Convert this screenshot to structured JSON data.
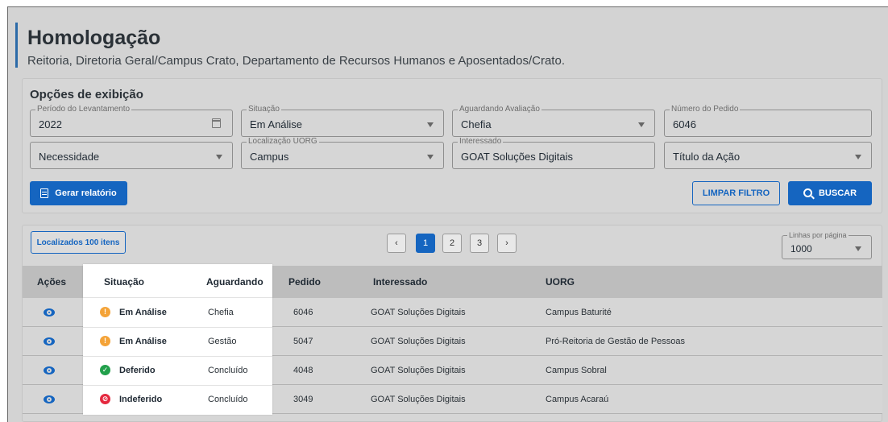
{
  "header": {
    "title": "Homologação",
    "subtitle": "Reitoria, Diretoria Geral/Campus Crato, Departamento de Recursos Humanos e Aposentados/Crato."
  },
  "filters": {
    "heading": "Opções de exibição",
    "periodo": {
      "legend": "Período do Levantamento",
      "value": "2022"
    },
    "situacao": {
      "legend": "Situação",
      "value": "Em Análise"
    },
    "aguardando": {
      "legend": "Aguardando Avaliação",
      "value": "Chefia"
    },
    "numero": {
      "legend": "Número do Pedido",
      "value": "6046"
    },
    "necessidade": {
      "value": "Necessidade"
    },
    "localizacao": {
      "legend": "Localização UORG",
      "value": "Campus"
    },
    "interessado": {
      "legend": "Interessado",
      "value": "GOAT Soluções Digitais"
    },
    "titulo": {
      "value": "Título da Ação"
    },
    "gerar_label": "Gerar relatório",
    "limpar_label": "LIMPAR FILTRO",
    "buscar_label": "BUSCAR"
  },
  "results": {
    "count_label": "Localizados 100 itens",
    "pages": [
      "1",
      "2",
      "3"
    ],
    "active_page": "1",
    "prev_symbol": "‹",
    "next_symbol": "›",
    "rows_per_page_legend": "Linhas por página",
    "rows_per_page_value": "1000"
  },
  "table": {
    "headers": [
      "Ações",
      "Situação",
      "Aguardando",
      "Pedido",
      "Interessado",
      "UORG"
    ],
    "rows": [
      {
        "status": "Em Análise",
        "status_kind": "warning",
        "aguardando": "Chefia",
        "pedido": "6046",
        "interessado": "GOAT Soluções Digitais",
        "uorg": "Campus Baturité"
      },
      {
        "status": "Em Análise",
        "status_kind": "warning",
        "aguardando": "Gestão",
        "pedido": "5047",
        "interessado": "GOAT Soluções Digitais",
        "uorg": "Pró-Reitoria de Gestão de Pessoas"
      },
      {
        "status": "Deferido",
        "status_kind": "success",
        "aguardando": "Concluído",
        "pedido": "4048",
        "interessado": "GOAT Soluções Digitais",
        "uorg": "Campus Sobral"
      },
      {
        "status": "Indeferido",
        "status_kind": "error",
        "aguardando": "Concluído",
        "pedido": "3049",
        "interessado": "GOAT Soluções Digitais",
        "uorg": "Campus Acaraú"
      }
    ]
  },
  "colors": {
    "primary": "#1565c0",
    "accent_bar": "#2b6aa8",
    "warning": "#f4a338",
    "success": "#22a04b",
    "error": "#e5293f"
  },
  "icons": {
    "calendar": "calendar-icon",
    "report": "document-icon",
    "search": "search-icon",
    "view": "eye-icon"
  }
}
